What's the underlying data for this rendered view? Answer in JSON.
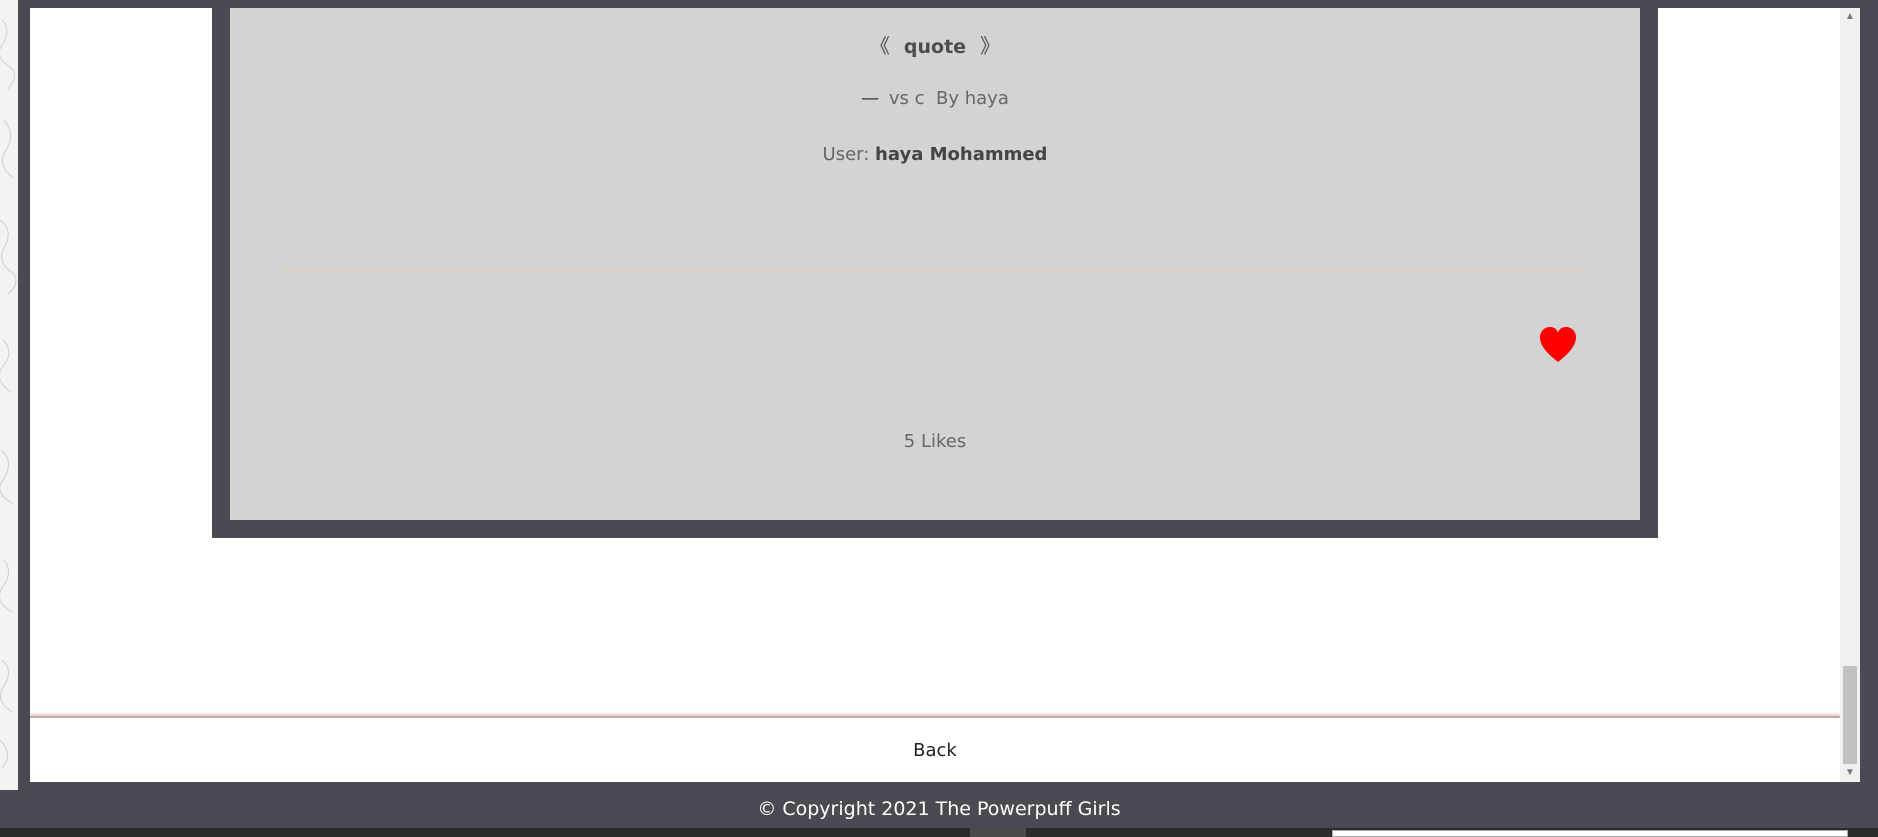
{
  "card": {
    "quote_open": "《",
    "quote_text": "quote",
    "quote_close": "》",
    "dash": "—",
    "title": "vs c",
    "by_label": "By haya",
    "user_label": "User:",
    "user_name": "haya Mohammed",
    "likes_text": "5 Likes"
  },
  "back_label": "Back",
  "footer": {
    "copyright": "© Copyright 2021 The Powerpuff Girls"
  },
  "colors": {
    "frame": "#4a4a53",
    "card_bg": "#d3d3d3",
    "heart": "#ff0000",
    "divider": "#e8d5a8"
  },
  "icons": [
    "heart-icon",
    "scroll-up-arrow-icon",
    "scroll-down-arrow-icon"
  ]
}
